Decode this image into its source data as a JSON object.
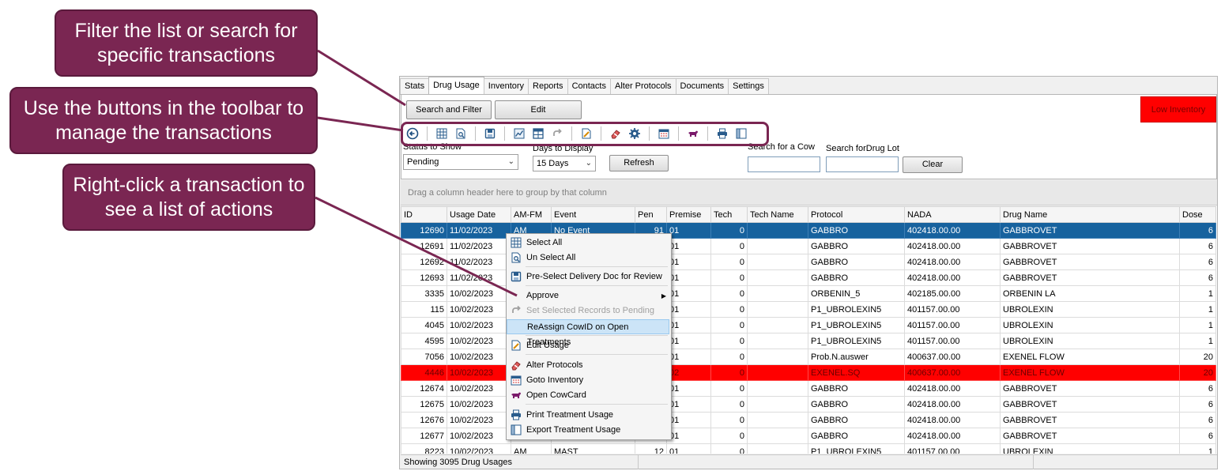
{
  "callouts": {
    "filter": "Filter the list or search for specific transactions",
    "toolbar": "Use the buttons in the toolbar to manage the transactions",
    "rightclick": "Right-click a transaction to see a list of actions"
  },
  "tabs": [
    "Stats",
    "Drug Usage",
    "Inventory",
    "Reports",
    "Contacts",
    "Alter Protocols",
    "Documents",
    "Settings"
  ],
  "active_tab": "Drug Usage",
  "buttons": {
    "search_filter": "Search and Filter",
    "edit": "Edit",
    "refresh": "Refresh",
    "clear": "Clear"
  },
  "low_inventory": "Low Inventory",
  "toolbar_icons": [
    "back-icon",
    "grid-icon",
    "search-doc-icon",
    "save-icon",
    "chart-icon",
    "grid-view-icon",
    "redo-icon",
    "edit-doc-icon",
    "eraser-icon",
    "settings-icon",
    "calendar-icon",
    "cow-icon",
    "print-icon",
    "columns-icon"
  ],
  "filters": {
    "status_label": "Status to Show",
    "status_value": "Pending",
    "days_label": "Days to Display",
    "days_value": "15 Days",
    "cow_label": "Search for a Cow",
    "drug_lot_label": "Search forDrug Lot"
  },
  "group_hint": "Drag a column header here to group by that column",
  "grid": {
    "columns": [
      "ID",
      "Usage Date",
      "AM-FM",
      "Event",
      "Pen",
      "Premise",
      "Tech",
      "Tech Name",
      "Protocol",
      "NADA",
      "Drug Name",
      "Dose"
    ],
    "rows": [
      [
        "12690",
        "11/02/2023",
        "AM",
        "No Event",
        "91",
        "01",
        "0",
        "",
        "GABBRO",
        "402418.00.00",
        "GABBROVET",
        "6"
      ],
      [
        "12691",
        "11/02/2023",
        "",
        "",
        "",
        "01",
        "0",
        "",
        "GABBRO",
        "402418.00.00",
        "GABBROVET",
        "6"
      ],
      [
        "12692",
        "11/02/2023",
        "",
        "",
        "",
        "01",
        "0",
        "",
        "GABBRO",
        "402418.00.00",
        "GABBROVET",
        "6"
      ],
      [
        "12693",
        "11/02/2023",
        "",
        "",
        "",
        "01",
        "0",
        "",
        "GABBRO",
        "402418.00.00",
        "GABBROVET",
        "6"
      ],
      [
        "3335",
        "10/02/2023",
        "",
        "",
        "",
        "01",
        "0",
        "",
        "ORBENIN_5",
        "402185.00.00",
        "ORBENIN LA",
        "1"
      ],
      [
        "115",
        "10/02/2023",
        "",
        "",
        "",
        "01",
        "0",
        "",
        "P1_UBROLEXIN5",
        "401157.00.00",
        "UBROLEXIN",
        "1"
      ],
      [
        "4045",
        "10/02/2023",
        "",
        "",
        "",
        "01",
        "0",
        "",
        "P1_UBROLEXIN5",
        "401157.00.00",
        "UBROLEXIN",
        "1"
      ],
      [
        "4595",
        "10/02/2023",
        "",
        "",
        "",
        "01",
        "0",
        "",
        "P1_UBROLEXIN5",
        "401157.00.00",
        "UBROLEXIN",
        "1"
      ],
      [
        "7056",
        "10/02/2023",
        "",
        "",
        "",
        "01",
        "0",
        "",
        "Prob.N.auswer",
        "400637.00.00",
        "EXENEL FLOW",
        "20"
      ],
      [
        "4446",
        "10/02/2023",
        "",
        "",
        "",
        "02",
        "0",
        "",
        "EXENEL.SQ",
        "400637.00.00",
        "EXENEL FLOW",
        "20"
      ],
      [
        "12674",
        "10/02/2023",
        "",
        "",
        "",
        "01",
        "0",
        "",
        "GABBRO",
        "402418.00.00",
        "GABBROVET",
        "6"
      ],
      [
        "12675",
        "10/02/2023",
        "",
        "",
        "",
        "01",
        "0",
        "",
        "GABBRO",
        "402418.00.00",
        "GABBROVET",
        "6"
      ],
      [
        "12676",
        "10/02/2023",
        "",
        "",
        "",
        "01",
        "0",
        "",
        "GABBRO",
        "402418.00.00",
        "GABBROVET",
        "6"
      ],
      [
        "12677",
        "10/02/2023",
        "",
        "",
        "",
        "01",
        "0",
        "",
        "GABBRO",
        "402418.00.00",
        "GABBROVET",
        "6"
      ],
      [
        "8223",
        "10/02/2023",
        "AM",
        "MAST",
        "12",
        "01",
        "0",
        "",
        "P1_UBROLEXIN5",
        "401157.00.00",
        "UBROLEXIN",
        "1"
      ]
    ]
  },
  "status_bar": "Showing 3095 Drug Usages",
  "context_menu": [
    {
      "label": "Select All",
      "icon": "grid-icon",
      "state": "normal"
    },
    {
      "label": "Un Select All",
      "icon": "search-doc-icon",
      "state": "normal"
    },
    {
      "label": "Pre-Select Delivery Doc for Review",
      "icon": "save-icon",
      "state": "normal"
    },
    {
      "label": "Approve",
      "icon": "",
      "state": "submenu"
    },
    {
      "label": "Set Selected Records to Pending",
      "icon": "redo-icon",
      "state": "disabled"
    },
    {
      "label": "ReAssign CowID on Open Treatments",
      "icon": "",
      "state": "highlighted"
    },
    {
      "label": "Edit Usage",
      "icon": "edit-doc-icon",
      "state": "normal"
    },
    {
      "label": "Alter Protocols",
      "icon": "eraser-icon",
      "state": "normal"
    },
    {
      "label": "Goto Inventory",
      "icon": "calendar-icon",
      "state": "normal"
    },
    {
      "label": "Open CowCard",
      "icon": "cow-icon",
      "state": "normal"
    },
    {
      "label": "Print Treatment Usage",
      "icon": "print-icon",
      "state": "normal"
    },
    {
      "label": "Export Treatment Usage",
      "icon": "columns-icon",
      "state": "normal"
    }
  ],
  "colors": {
    "callout": "#7a2652",
    "selected_row": "#17629e",
    "alert_row": "#ff0000",
    "menu_highlight": "#cce4f7"
  }
}
